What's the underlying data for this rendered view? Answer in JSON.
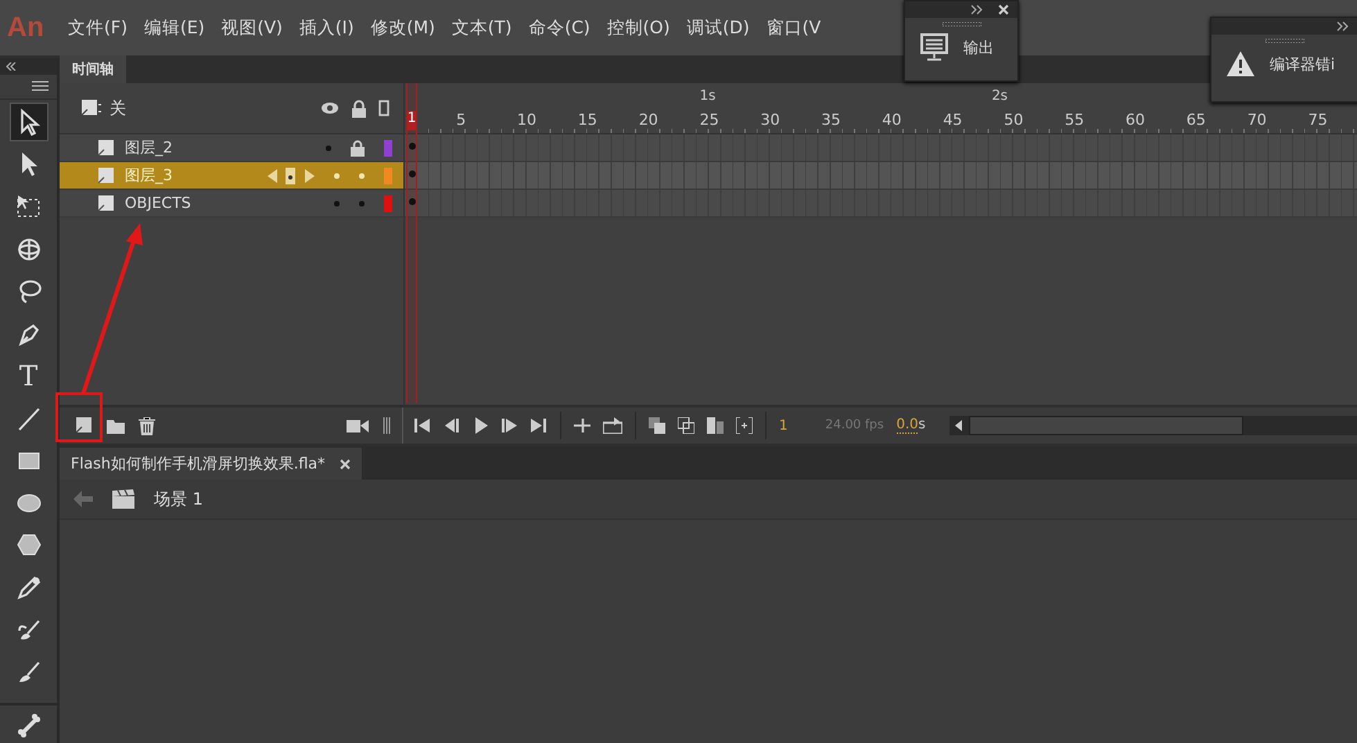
{
  "app": {
    "logo": "An"
  },
  "menu": [
    "文件(F)",
    "编辑(E)",
    "视图(V)",
    "插入(I)",
    "修改(M)",
    "文本(T)",
    "命令(C)",
    "控制(O)",
    "调试(D)",
    "窗口(V"
  ],
  "floating_panels": [
    {
      "kind": "output",
      "label": "输出",
      "closable": true
    },
    {
      "kind": "errors",
      "label": "编译器错i",
      "closable": false
    }
  ],
  "tools": [
    {
      "kind": "select",
      "selected": true
    },
    {
      "kind": "subselect",
      "selected": false
    },
    {
      "kind": "transform",
      "selected": false
    },
    {
      "kind": "rotate3d",
      "selected": false
    },
    {
      "kind": "lasso",
      "selected": false
    },
    {
      "kind": "pen",
      "selected": false
    },
    {
      "kind": "text",
      "glyph": "T",
      "selected": false
    },
    {
      "kind": "line",
      "selected": false
    },
    {
      "kind": "rect",
      "selected": false
    },
    {
      "kind": "oval",
      "selected": false
    },
    {
      "kind": "polystar",
      "selected": false
    },
    {
      "kind": "pencil",
      "selected": false
    },
    {
      "kind": "brush",
      "selected": false
    },
    {
      "kind": "paintbrush",
      "selected": false
    },
    {
      "kind": "bone",
      "selected": false
    }
  ],
  "timeline": {
    "tab": "时间轴",
    "header_label": "关",
    "seconds": [
      "1s",
      "2s"
    ],
    "frame_numbers": [
      "1",
      "5",
      "10",
      "15",
      "20",
      "25",
      "30",
      "35",
      "40",
      "45",
      "50",
      "55",
      "60",
      "65",
      "70",
      "75"
    ],
    "layers": [
      {
        "name": "图层_2",
        "selected": false,
        "locked": true,
        "color": "#9040d0"
      },
      {
        "name": "图层_3",
        "selected": true,
        "locked": false,
        "color": "#f08a20"
      },
      {
        "name": "OBJECTS",
        "selected": false,
        "locked": false,
        "color": "#e01010"
      }
    ],
    "current_frame": "1",
    "fps": "24.00 fps",
    "time": "0.0",
    "time_unit": "s"
  },
  "document": {
    "tab": "Flash如何制作手机滑屏切换效果.fla*",
    "scene": "场景 1"
  }
}
